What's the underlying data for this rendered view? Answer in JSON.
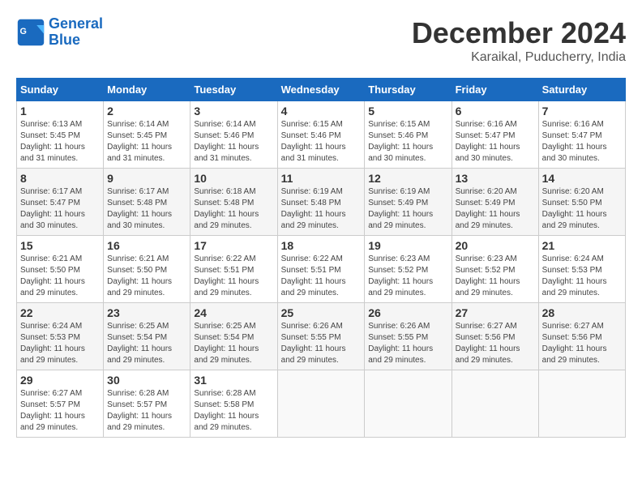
{
  "logo": {
    "line1": "General",
    "line2": "Blue"
  },
  "header": {
    "month": "December 2024",
    "location": "Karaikal, Puducherry, India"
  },
  "weekdays": [
    "Sunday",
    "Monday",
    "Tuesday",
    "Wednesday",
    "Thursday",
    "Friday",
    "Saturday"
  ],
  "weeks": [
    [
      {
        "day": "1",
        "sunrise": "6:13 AM",
        "sunset": "5:45 PM",
        "daylight": "11 hours and 31 minutes."
      },
      {
        "day": "2",
        "sunrise": "6:14 AM",
        "sunset": "5:45 PM",
        "daylight": "11 hours and 31 minutes."
      },
      {
        "day": "3",
        "sunrise": "6:14 AM",
        "sunset": "5:46 PM",
        "daylight": "11 hours and 31 minutes."
      },
      {
        "day": "4",
        "sunrise": "6:15 AM",
        "sunset": "5:46 PM",
        "daylight": "11 hours and 31 minutes."
      },
      {
        "day": "5",
        "sunrise": "6:15 AM",
        "sunset": "5:46 PM",
        "daylight": "11 hours and 30 minutes."
      },
      {
        "day": "6",
        "sunrise": "6:16 AM",
        "sunset": "5:47 PM",
        "daylight": "11 hours and 30 minutes."
      },
      {
        "day": "7",
        "sunrise": "6:16 AM",
        "sunset": "5:47 PM",
        "daylight": "11 hours and 30 minutes."
      }
    ],
    [
      {
        "day": "8",
        "sunrise": "6:17 AM",
        "sunset": "5:47 PM",
        "daylight": "11 hours and 30 minutes."
      },
      {
        "day": "9",
        "sunrise": "6:17 AM",
        "sunset": "5:48 PM",
        "daylight": "11 hours and 30 minutes."
      },
      {
        "day": "10",
        "sunrise": "6:18 AM",
        "sunset": "5:48 PM",
        "daylight": "11 hours and 29 minutes."
      },
      {
        "day": "11",
        "sunrise": "6:19 AM",
        "sunset": "5:48 PM",
        "daylight": "11 hours and 29 minutes."
      },
      {
        "day": "12",
        "sunrise": "6:19 AM",
        "sunset": "5:49 PM",
        "daylight": "11 hours and 29 minutes."
      },
      {
        "day": "13",
        "sunrise": "6:20 AM",
        "sunset": "5:49 PM",
        "daylight": "11 hours and 29 minutes."
      },
      {
        "day": "14",
        "sunrise": "6:20 AM",
        "sunset": "5:50 PM",
        "daylight": "11 hours and 29 minutes."
      }
    ],
    [
      {
        "day": "15",
        "sunrise": "6:21 AM",
        "sunset": "5:50 PM",
        "daylight": "11 hours and 29 minutes."
      },
      {
        "day": "16",
        "sunrise": "6:21 AM",
        "sunset": "5:50 PM",
        "daylight": "11 hours and 29 minutes."
      },
      {
        "day": "17",
        "sunrise": "6:22 AM",
        "sunset": "5:51 PM",
        "daylight": "11 hours and 29 minutes."
      },
      {
        "day": "18",
        "sunrise": "6:22 AM",
        "sunset": "5:51 PM",
        "daylight": "11 hours and 29 minutes."
      },
      {
        "day": "19",
        "sunrise": "6:23 AM",
        "sunset": "5:52 PM",
        "daylight": "11 hours and 29 minutes."
      },
      {
        "day": "20",
        "sunrise": "6:23 AM",
        "sunset": "5:52 PM",
        "daylight": "11 hours and 29 minutes."
      },
      {
        "day": "21",
        "sunrise": "6:24 AM",
        "sunset": "5:53 PM",
        "daylight": "11 hours and 29 minutes."
      }
    ],
    [
      {
        "day": "22",
        "sunrise": "6:24 AM",
        "sunset": "5:53 PM",
        "daylight": "11 hours and 29 minutes."
      },
      {
        "day": "23",
        "sunrise": "6:25 AM",
        "sunset": "5:54 PM",
        "daylight": "11 hours and 29 minutes."
      },
      {
        "day": "24",
        "sunrise": "6:25 AM",
        "sunset": "5:54 PM",
        "daylight": "11 hours and 29 minutes."
      },
      {
        "day": "25",
        "sunrise": "6:26 AM",
        "sunset": "5:55 PM",
        "daylight": "11 hours and 29 minutes."
      },
      {
        "day": "26",
        "sunrise": "6:26 AM",
        "sunset": "5:55 PM",
        "daylight": "11 hours and 29 minutes."
      },
      {
        "day": "27",
        "sunrise": "6:27 AM",
        "sunset": "5:56 PM",
        "daylight": "11 hours and 29 minutes."
      },
      {
        "day": "28",
        "sunrise": "6:27 AM",
        "sunset": "5:56 PM",
        "daylight": "11 hours and 29 minutes."
      }
    ],
    [
      {
        "day": "29",
        "sunrise": "6:27 AM",
        "sunset": "5:57 PM",
        "daylight": "11 hours and 29 minutes."
      },
      {
        "day": "30",
        "sunrise": "6:28 AM",
        "sunset": "5:57 PM",
        "daylight": "11 hours and 29 minutes."
      },
      {
        "day": "31",
        "sunrise": "6:28 AM",
        "sunset": "5:58 PM",
        "daylight": "11 hours and 29 minutes."
      },
      null,
      null,
      null,
      null
    ]
  ]
}
